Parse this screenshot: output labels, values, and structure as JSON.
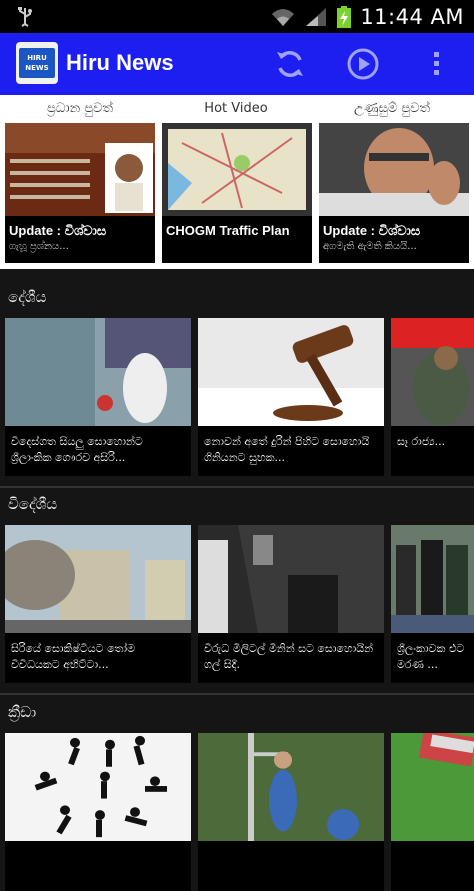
{
  "status_bar": {
    "time": "11:44 AM"
  },
  "app_bar": {
    "title": "Hiru News",
    "logo_text": "HIRU NEWS"
  },
  "hot_strip": {
    "labels": [
      "ප්‍රධාන පුවත්",
      "Hot Video",
      "උණුසුම් පුවත්"
    ],
    "cards": [
      {
        "caption": "Update : විශ්වාස",
        "subcaption": "ගැහූ ප්‍රශ්නය..."
      },
      {
        "caption": "CHOGM Traffic Plan",
        "subcaption": ""
      },
      {
        "caption": "Update : විශ්වාස",
        "subcaption": "අගමැති ඇමති කියයි..."
      }
    ]
  },
  "sections": [
    {
      "title": "දේශීය",
      "cards": [
        {
          "text": "විදෙස්ගත සියලු සොහොන්ට ශ්‍රීලාංකික ගෞරව අසිරි..."
        },
        {
          "text": "නොවන් අතේ දුරින් පිහිට සොහොයි ගිනියනට සුභක..."
        },
        {
          "text": "සෑ රාජ්‍ය..."
        }
      ]
    },
    {
      "title": "විදේශීය",
      "cards": [
        {
          "text": "සිරියේ සොකිෂ්ටියට තෝම විවිධයකට අභිට්ටා..."
        },
        {
          "text": "විරුධ මිලිටල් මිනින් සට සොහොයින් ගල් සිදී."
        },
        {
          "text": "ශ්‍රීලංකාවක එට මරණ ..."
        }
      ]
    },
    {
      "title": "ක්‍රීඩා",
      "cards": [
        {
          "text": ""
        },
        {
          "text": ""
        },
        {
          "text": ""
        }
      ]
    }
  ]
}
